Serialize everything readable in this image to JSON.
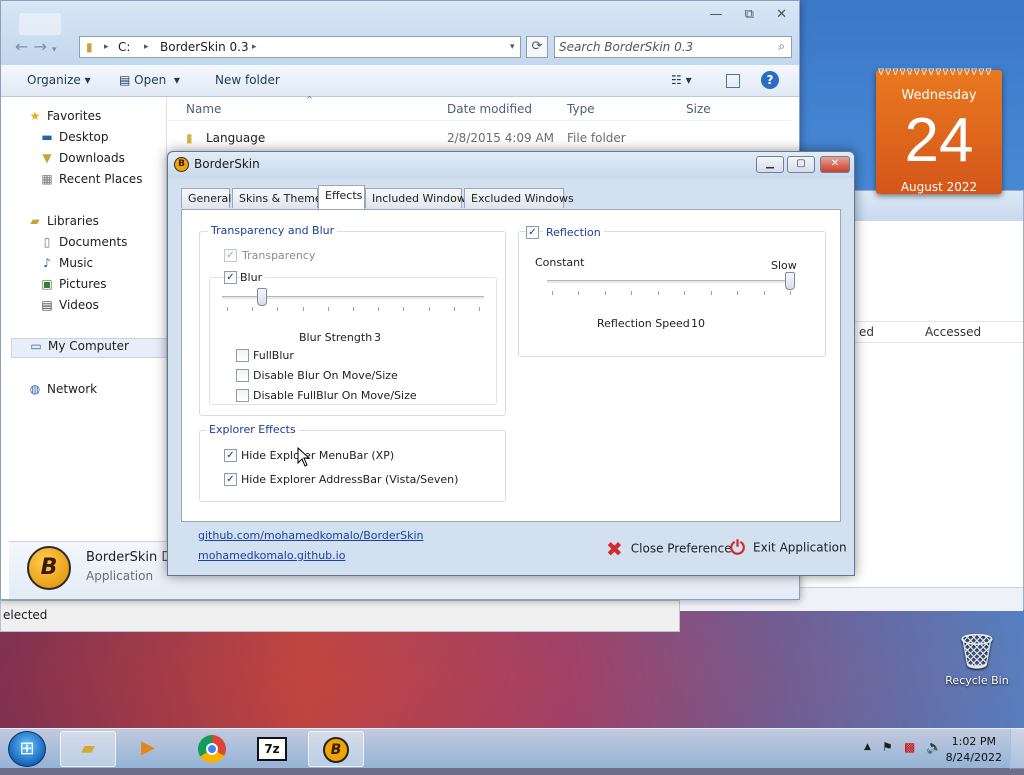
{
  "explorer": {
    "address": {
      "drive": "C:",
      "folder": "BorderSkin 0.3"
    },
    "search_placeholder": "Search BorderSkin 0.3",
    "toolbar": {
      "organize": "Organize",
      "open": "Open",
      "new_folder": "New folder"
    },
    "nav": {
      "favorites": "Favorites",
      "desktop": "Desktop",
      "downloads": "Downloads",
      "recent_places": "Recent Places",
      "libraries": "Libraries",
      "documents": "Documents",
      "music": "Music",
      "pictures": "Pictures",
      "videos": "Videos",
      "my_computer": "My Computer",
      "network": "Network"
    },
    "columns": {
      "name": "Name",
      "date_modified": "Date modified",
      "type": "Type",
      "size": "Size"
    },
    "rows": [
      {
        "name": "Language",
        "date": "2/8/2015 4:09 AM",
        "type": "File folder"
      }
    ],
    "details": {
      "name": "BorderSkin",
      "name_suffix": "Da",
      "type": "Application"
    },
    "status": "elected"
  },
  "back_window": {
    "col_partial": "ed",
    "col_accessed": "Accessed"
  },
  "calendar": {
    "weekday": "Wednesday",
    "day": "24",
    "month": "August 2022"
  },
  "dialog": {
    "title": "BorderSkin",
    "tabs": [
      "General",
      "Skins & Themes",
      "Effects",
      "Included Windows",
      "Excluded Windows"
    ],
    "active_tab": "Effects",
    "transparency_group": {
      "title": "Transparency and Blur",
      "transparency": "Transparency",
      "blur": "Blur",
      "blur_strength_label": "Blur Strength",
      "blur_strength_value": "3",
      "blur_strength_fraction": 0.14,
      "fullblur": "FullBlur",
      "disable_blur": "Disable Blur On Move/Size",
      "disable_fullblur": "Disable FullBlur On Move/Size"
    },
    "explorer_group": {
      "title": "Explorer Effects",
      "hide_menubar": "Hide Explorer MenuBar (XP)",
      "hide_addressbar": "Hide Explorer AddressBar (Vista/Seven)"
    },
    "reflection_group": {
      "title": "Reflection",
      "constant": "Constant",
      "slow": "Slow",
      "speed_label": "Reflection Speed",
      "speed_value": "10",
      "speed_fraction": 1.0
    },
    "links": {
      "github": "github.com/mohamedkomalo/BorderSkin",
      "site": "mohamedkomalo.github.io"
    },
    "close_pref": "Close Preference",
    "exit_app": "Exit Application"
  },
  "desktop": {
    "recycle_bin": "Recycle Bin"
  },
  "taskbar": {
    "time": "1:02 PM",
    "date": "8/24/2022",
    "apps": [
      "explorer-icon",
      "media-player-icon",
      "chrome-icon",
      "7zip-icon",
      "borderskin-icon"
    ]
  }
}
